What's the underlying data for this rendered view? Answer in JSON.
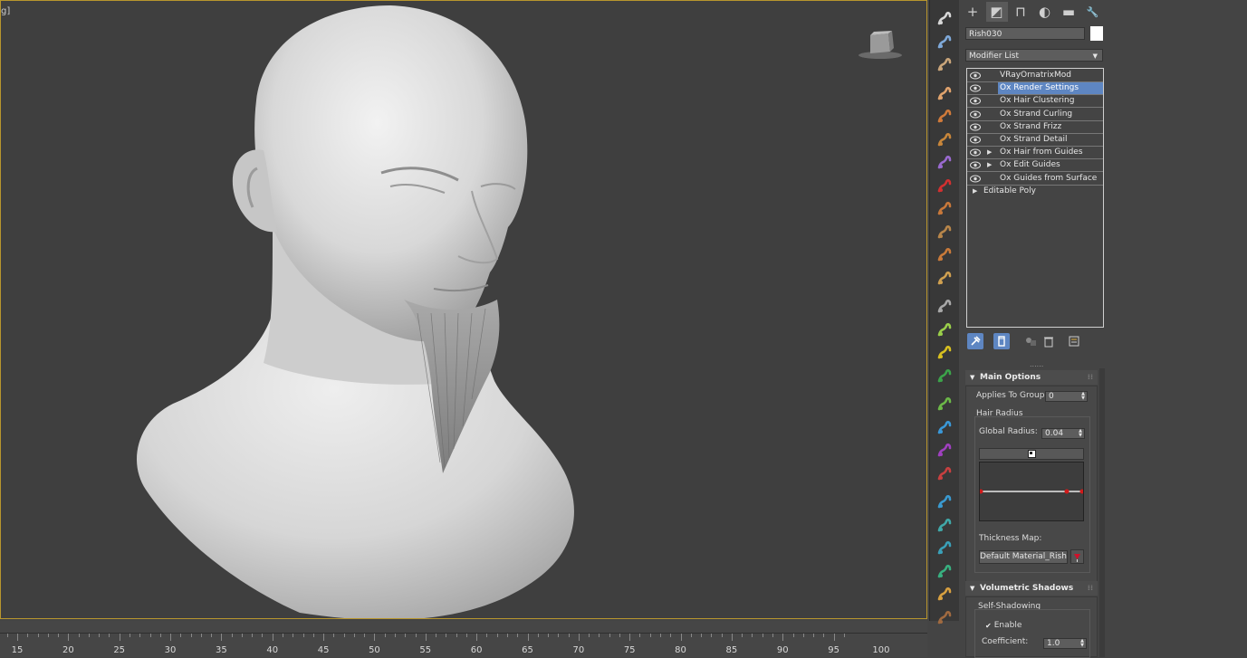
{
  "viewport": {
    "label": "g]",
    "viewcube_icon": "viewcube-icon",
    "border_color": "#b8962e"
  },
  "timeline": {
    "ticks": [
      "15",
      "20",
      "25",
      "30",
      "35",
      "40",
      "45",
      "50",
      "55",
      "60",
      "65",
      "70",
      "75",
      "80",
      "85",
      "90",
      "95",
      "100"
    ]
  },
  "ornatrix_toolbar": {
    "icons": [
      "hair-from-mesh-strips-icon",
      "guides-editor-icon",
      "ground-strands-icon",
      "strand-propagation-icon",
      "curl-icon",
      "hair-clustering-icon",
      "strand-frizz-icon",
      "render-settings-icon",
      "surface-comb-icon",
      "strand-multiplier-icon",
      "change-width-icon",
      "edit-guides-icon",
      "symmetry-icon",
      "length-icon",
      "detail-icon",
      "gravity-icon",
      "mesh-from-strands-icon",
      "strand-group-icon",
      "braid-icon",
      "rotate-icon",
      "frizz-icon",
      "push-away-icon",
      "collision-icon",
      "strand-animation-icon",
      "weaver-icon",
      "weather-icon"
    ]
  },
  "command_panel": {
    "tabs": [
      {
        "icon": "create-plus-icon",
        "glyph": "+"
      },
      {
        "icon": "modify-icon",
        "glyph": "◩"
      },
      {
        "icon": "hierarchy-icon",
        "glyph": "⊓"
      },
      {
        "icon": "motion-icon",
        "glyph": "◐"
      },
      {
        "icon": "display-icon",
        "glyph": "▬"
      },
      {
        "icon": "utilities-wrench-icon",
        "glyph": "🔧"
      }
    ],
    "object_name": "Rish030",
    "object_color": "#ffffff",
    "modifier_list_label": "Modifier List",
    "stack": [
      {
        "label": "VRayOrnatrixMod",
        "eye": true,
        "arrow": false,
        "selected": false
      },
      {
        "label": "Ox Render Settings",
        "eye": true,
        "arrow": false,
        "selected": true
      },
      {
        "label": "Ox Hair Clustering",
        "eye": true,
        "arrow": false,
        "selected": false
      },
      {
        "label": "Ox Strand Curling",
        "eye": true,
        "arrow": false,
        "selected": false
      },
      {
        "label": "Ox Strand Frizz",
        "eye": true,
        "arrow": false,
        "selected": false
      },
      {
        "label": "Ox Strand Detail",
        "eye": true,
        "arrow": false,
        "selected": false
      },
      {
        "label": "Ox Hair from Guides",
        "eye": true,
        "arrow": true,
        "selected": false
      },
      {
        "label": "Ox Edit Guides",
        "eye": true,
        "arrow": true,
        "selected": false
      },
      {
        "label": "Ox Guides from Surface",
        "eye": true,
        "arrow": false,
        "selected": false
      },
      {
        "label": "Editable Poly",
        "eye": false,
        "arrow": true,
        "selected": false
      }
    ],
    "stack_tools": [
      "pin-stack-icon",
      "show-end-result-icon",
      "make-unique-icon",
      "remove-modifier-icon",
      "configure-modifier-sets-icon"
    ],
    "main_options": {
      "title": "Main Options",
      "applies_to_group_label": "Applies To Group:",
      "applies_to_group_value": "0",
      "hair_radius_group": "Hair Radius",
      "global_radius_label": "Global Radius:",
      "global_radius_value": "0.04",
      "curve_button_icon": "curve-editor-icon",
      "thickness_map_label": "Thickness Map:",
      "thickness_map_value": "Default Material_Rish Jel",
      "map_pick_icon": "eyedropper-icon"
    },
    "volumetric_shadows": {
      "title": "Volumetric Shadows",
      "self_shadowing_group": "Self-Shadowing",
      "enable_label": "Enable",
      "enable_checked": "✔",
      "coefficient_label": "Coefficient:",
      "coefficient_value": "1.0"
    }
  }
}
